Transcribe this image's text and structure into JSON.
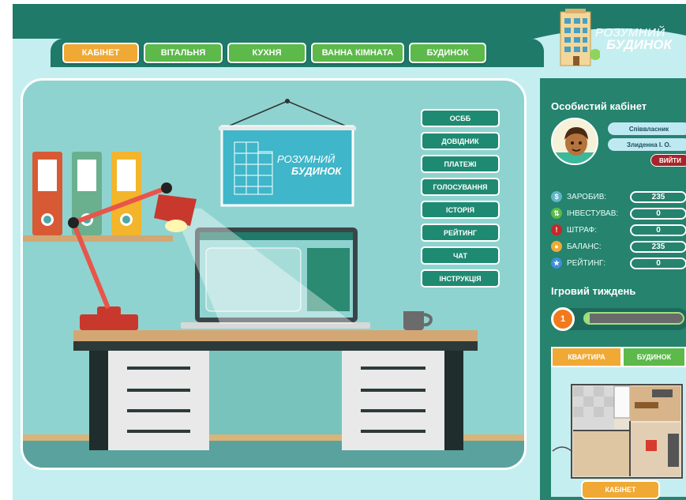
{
  "nav": {
    "tabs": [
      {
        "label": "КАБІНЕТ",
        "active": true
      },
      {
        "label": "ВІТАЛЬНЯ",
        "active": false
      },
      {
        "label": "КУХНЯ",
        "active": false
      },
      {
        "label": "ВАННА КІМНАТА",
        "active": false
      },
      {
        "label": "БУДИНОК",
        "active": false
      }
    ]
  },
  "logo": {
    "line1": "РОЗУМНИЙ",
    "line2": "БУДИНОК"
  },
  "poster": {
    "line1": "РОЗУМНИЙ",
    "line2": "БУДИНОК"
  },
  "menu": {
    "items": [
      "ОСББ",
      "ДОВІДНИК",
      "ПЛАТЕЖІ",
      "ГОЛОСУВАННЯ",
      "ІСТОРІЯ",
      "РЕЙТИНГ",
      "ЧАТ",
      "ІНСТРУКЦІЯ"
    ]
  },
  "profile": {
    "title": "Особистий кабінет",
    "role": "Співвласник",
    "name": "Злиденна І. О.",
    "logout_label": "ВИЙТИ"
  },
  "stats": [
    {
      "label": "ЗАРОБИВ:",
      "value": "235",
      "icon": "money-bag-icon",
      "color": "#5fb5c8"
    },
    {
      "label": "ІНВЕСТУВАВ:",
      "value": "0",
      "icon": "invest-icon",
      "color": "#5cb94a"
    },
    {
      "label": "ШТРАФ:",
      "value": "0",
      "icon": "exclamation-icon",
      "color": "#c62828"
    },
    {
      "label": "БАЛАНС:",
      "value": "235",
      "icon": "coins-icon",
      "color": "#f0a934"
    },
    {
      "label": "РЕЙТИНГ:",
      "value": "0",
      "icon": "star-icon",
      "color": "#3c8fd8"
    }
  ],
  "week": {
    "title": "Ігровий тиждень",
    "number": "1",
    "progress": 0.05
  },
  "plan": {
    "tab_apartment": "КВАРТИРА",
    "tab_house": "БУДИНОК"
  },
  "bottom_button": "КАБІНЕТ",
  "colors": {
    "header_green": "#1f7a6a",
    "accent_orange": "#f0a934",
    "accent_green": "#5cb94a",
    "panel": "#25836e"
  }
}
